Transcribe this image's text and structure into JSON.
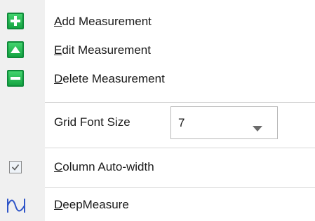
{
  "menu": {
    "add": {
      "prefix": "",
      "accel": "A",
      "rest": "dd Measurement"
    },
    "edit": {
      "prefix": "",
      "accel": "E",
      "rest": "dit Measurement"
    },
    "delete": {
      "prefix": "",
      "accel": "D",
      "rest": "elete Measurement"
    },
    "grid_font": {
      "label": "Grid Font Size",
      "value": "7"
    },
    "column_autowidth": {
      "accel": "C",
      "rest": "olumn Auto-width",
      "checked": true
    },
    "deepmeasure": {
      "accel": "D",
      "rest": "eepMeasure"
    }
  },
  "icons": {
    "add": "plus-square-icon",
    "edit": "up-triangle-square-icon",
    "delete": "minus-square-icon",
    "checkbox": "check-icon",
    "deepmeasure": "waveform-icon"
  },
  "colors": {
    "gutter": "#f0f0f0",
    "icon_green": "#1fb14b",
    "icon_blue": "#2f55c8"
  }
}
